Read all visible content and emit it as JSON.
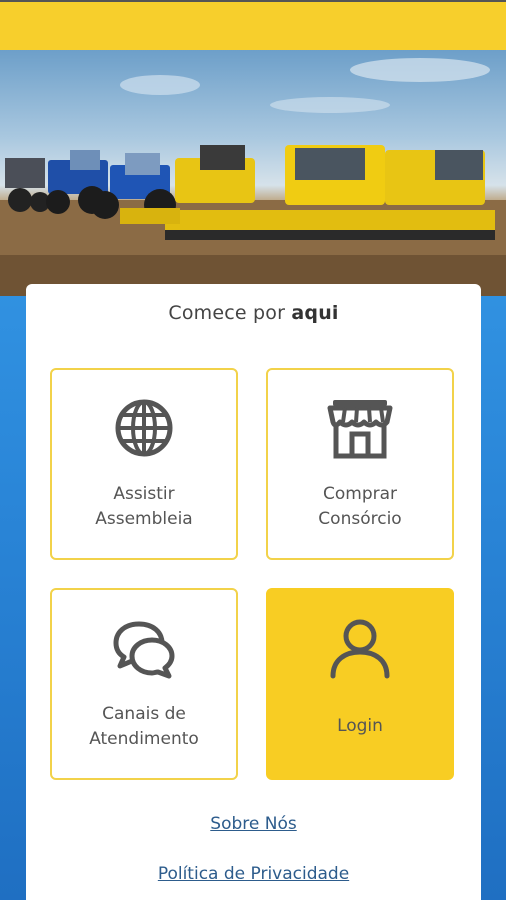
{
  "heading": {
    "prefix": "Comece por",
    "bold": "aqui"
  },
  "tiles": [
    {
      "line1": "Assistir",
      "line2": "Assembleia",
      "icon": "globe-icon"
    },
    {
      "line1": "Comprar",
      "line2": "Consórcio",
      "icon": "store-icon"
    },
    {
      "line1": "Canais de",
      "line2": "Atendimento",
      "icon": "chat-icon"
    },
    {
      "line1": "Login",
      "line2": "",
      "icon": "user-icon"
    }
  ],
  "links": {
    "about": "Sobre Nós",
    "privacy": "Política de Privacidade"
  },
  "colors": {
    "brand_yellow": "#f7cf2c",
    "tile_border": "#f2d24a",
    "link": "#2d5c8c",
    "icon": "#555555"
  }
}
